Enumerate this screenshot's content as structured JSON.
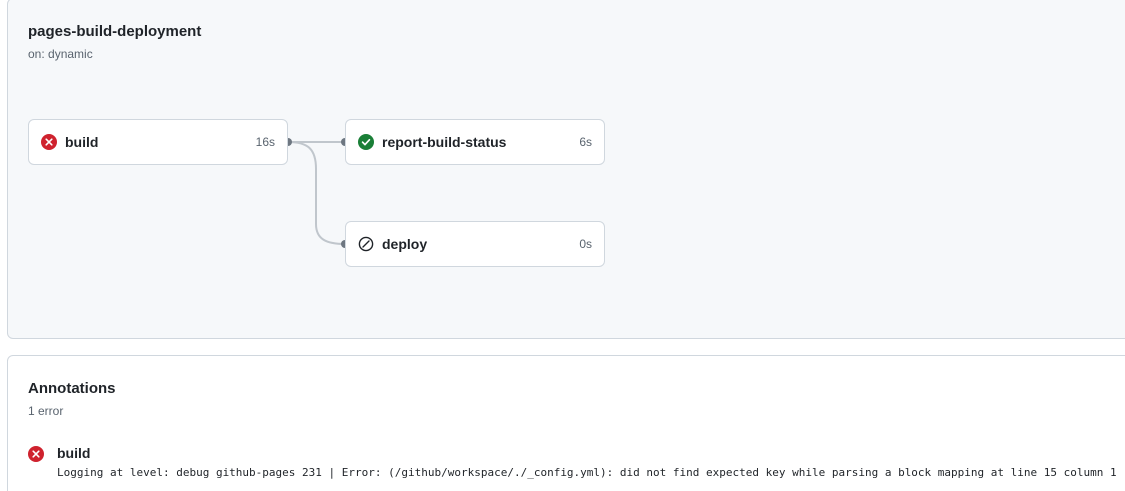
{
  "workflow": {
    "title": "pages-build-deployment",
    "trigger": "on: dynamic"
  },
  "jobs": [
    {
      "name": "build",
      "duration": "16s",
      "status": "failure",
      "status_icon": "x-circle-fill-icon",
      "status_color": "#cf222e"
    },
    {
      "name": "report-build-status",
      "duration": "6s",
      "status": "success",
      "status_icon": "check-circle-fill-icon",
      "status_color": "#1a7f37"
    },
    {
      "name": "deploy",
      "duration": "0s",
      "status": "skipped",
      "status_icon": "skip-icon",
      "status_color": "#59636e"
    }
  ],
  "annotations": {
    "title": "Annotations",
    "count": "1 error",
    "items": [
      {
        "title": "build",
        "level": "error",
        "icon": "x-circle-fill-icon",
        "message": "Logging at level: debug github-pages 231 | Error: (/github/workspace/./_config.yml): did not find expected key while parsing a block mapping at line 15 column 1"
      }
    ]
  },
  "colors": {
    "error": "#cf222e",
    "success": "#1a7f37",
    "muted": "#59636e",
    "border": "#d0d7de",
    "panel_bg": "#f6f8fa"
  }
}
